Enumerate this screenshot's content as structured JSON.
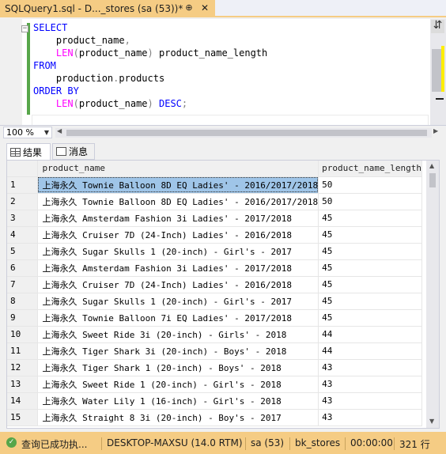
{
  "tab": {
    "title": "SQLQuery1.sql - D..._stores (sa (53))*",
    "pin": "⊕",
    "close": "✕"
  },
  "editor": {
    "lines": [
      [
        {
          "t": "SELECT",
          "c": "kw"
        }
      ],
      [
        {
          "t": "    product_name",
          "c": "id"
        },
        {
          "t": ",",
          "c": "gr"
        }
      ],
      [
        {
          "t": "    ",
          "c": "id"
        },
        {
          "t": "LEN",
          "c": "fn"
        },
        {
          "t": "(",
          "c": "gr"
        },
        {
          "t": "product_name",
          "c": "id"
        },
        {
          "t": ")",
          "c": "gr"
        },
        {
          "t": " product_name_length",
          "c": "id"
        }
      ],
      [
        {
          "t": "FROM",
          "c": "kw"
        }
      ],
      [
        {
          "t": "    production",
          "c": "id"
        },
        {
          "t": ".",
          "c": "gr"
        },
        {
          "t": "products",
          "c": "id"
        }
      ],
      [
        {
          "t": "ORDER BY",
          "c": "kw"
        }
      ],
      [
        {
          "t": "    ",
          "c": "id"
        },
        {
          "t": "LEN",
          "c": "fn"
        },
        {
          "t": "(",
          "c": "gr"
        },
        {
          "t": "product_name",
          "c": "id"
        },
        {
          "t": ")",
          "c": "gr"
        },
        {
          "t": " ",
          "c": "id"
        },
        {
          "t": "DESC",
          "c": "kw"
        },
        {
          "t": ";",
          "c": "gr"
        }
      ]
    ],
    "collapse": "−"
  },
  "zoom": {
    "value": "100 %"
  },
  "result_tabs": {
    "results": "结果",
    "messages": "消息"
  },
  "grid": {
    "columns": [
      "product_name",
      "product_name_length"
    ],
    "rows": [
      [
        "1",
        "上海永久 Townie Balloon 8D EQ Ladies' - 2016/2017/2018",
        "50"
      ],
      [
        "2",
        "上海永久 Townie Balloon 8D EQ Ladies' - 2016/2017/2018",
        "50"
      ],
      [
        "3",
        "上海永久 Amsterdam Fashion 3i Ladies' - 2017/2018",
        "45"
      ],
      [
        "4",
        "上海永久 Cruiser 7D (24-Inch) Ladies' - 2016/2018",
        "45"
      ],
      [
        "5",
        "上海永久 Sugar Skulls 1 (20-inch) - Girl's - 2017",
        "45"
      ],
      [
        "6",
        "上海永久 Amsterdam Fashion 3i Ladies' - 2017/2018",
        "45"
      ],
      [
        "7",
        "上海永久 Cruiser 7D (24-Inch) Ladies' - 2016/2018",
        "45"
      ],
      [
        "8",
        "上海永久 Sugar Skulls 1 (20-inch) - Girl's - 2017",
        "45"
      ],
      [
        "9",
        "上海永久 Townie Balloon 7i EQ Ladies' - 2017/2018",
        "45"
      ],
      [
        "10",
        "上海永久 Sweet Ride 3i (20-inch) - Girls' - 2018",
        "44"
      ],
      [
        "11",
        "上海永久 Tiger Shark 3i (20-inch) - Boys' - 2018",
        "44"
      ],
      [
        "12",
        "上海永久 Tiger Shark 1 (20-inch) - Boys' - 2018",
        "43"
      ],
      [
        "13",
        "上海永久 Sweet Ride 1 (20-inch) - Girl's - 2018",
        "43"
      ],
      [
        "14",
        "上海永久 Water Lily 1 (16-inch) - Girl's - 2018",
        "43"
      ],
      [
        "15",
        "上海永久 Straight 8 3i (20-inch) - Boy's - 2017",
        "43"
      ]
    ]
  },
  "status": {
    "message": "查询已成功执...",
    "server": "DESKTOP-MAXSU (14.0 RTM)",
    "user": "sa (53)",
    "database": "bk_stores",
    "elapsed": "00:00:00",
    "rows": "321 行"
  },
  "colors": {
    "accent": "#f5cc84",
    "keyword": "#0000ff",
    "function": "#ff00ff",
    "selection": "#9fc5e8"
  }
}
